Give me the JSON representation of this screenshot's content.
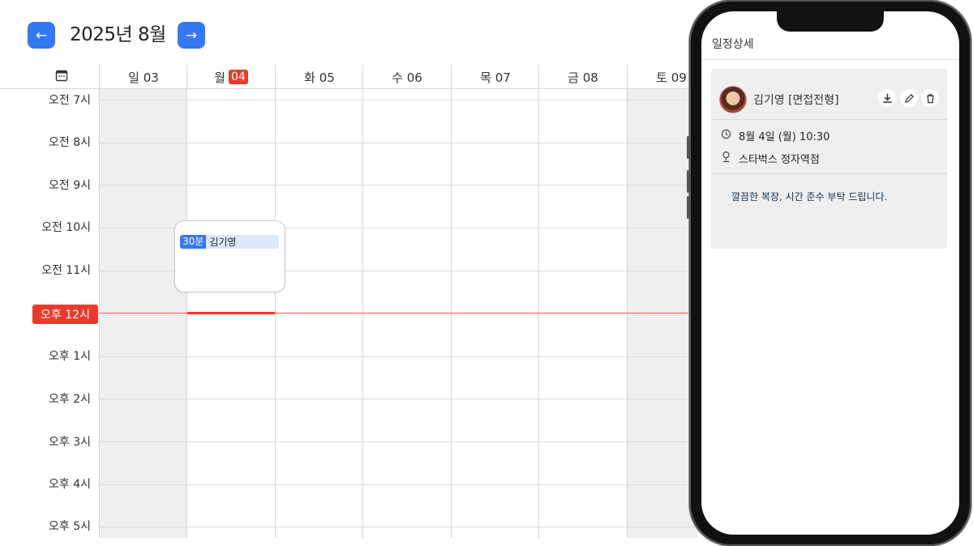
{
  "header": {
    "prev_icon": "arrow-left-icon",
    "next_icon": "arrow-right-icon",
    "prev_glyph": "←",
    "next_glyph": "→",
    "month_title": "2025년 8월"
  },
  "calendar": {
    "days": [
      {
        "label": "일 03",
        "weekend": true
      },
      {
        "label": "월",
        "num": "04",
        "today": true
      },
      {
        "label": "화 05"
      },
      {
        "label": "수 06"
      },
      {
        "label": "목 07"
      },
      {
        "label": "금 08"
      },
      {
        "label": "토 09",
        "weekend": true
      }
    ],
    "time_labels": [
      "오전 7시",
      "오전 8시",
      "오전 9시",
      "오전 10시",
      "오전 11시",
      "오후 12시",
      "오후 1시",
      "오후 2시",
      "오후 3시",
      "오후 4시",
      "오후 5시"
    ],
    "current_time_label": "오후 12시",
    "event": {
      "duration": "30분",
      "name": "김기영"
    }
  },
  "detail": {
    "title": "일정상세",
    "person": "김기영 [면접전형]",
    "actions": [
      {
        "icon": "download-icon",
        "glyph": "⤓"
      },
      {
        "icon": "edit-icon",
        "glyph": "✎"
      },
      {
        "icon": "trash-icon",
        "glyph": "🗑"
      }
    ],
    "datetime": "8월 4일 (월) 10:30",
    "location": "스타벅스 정자역점",
    "memo": "깔끔한 복장, 시간 준수 부탁 드립니다.",
    "colors": {
      "accent": "#3478f6",
      "today": "#ea3a2c",
      "panel": "#efefef"
    }
  }
}
